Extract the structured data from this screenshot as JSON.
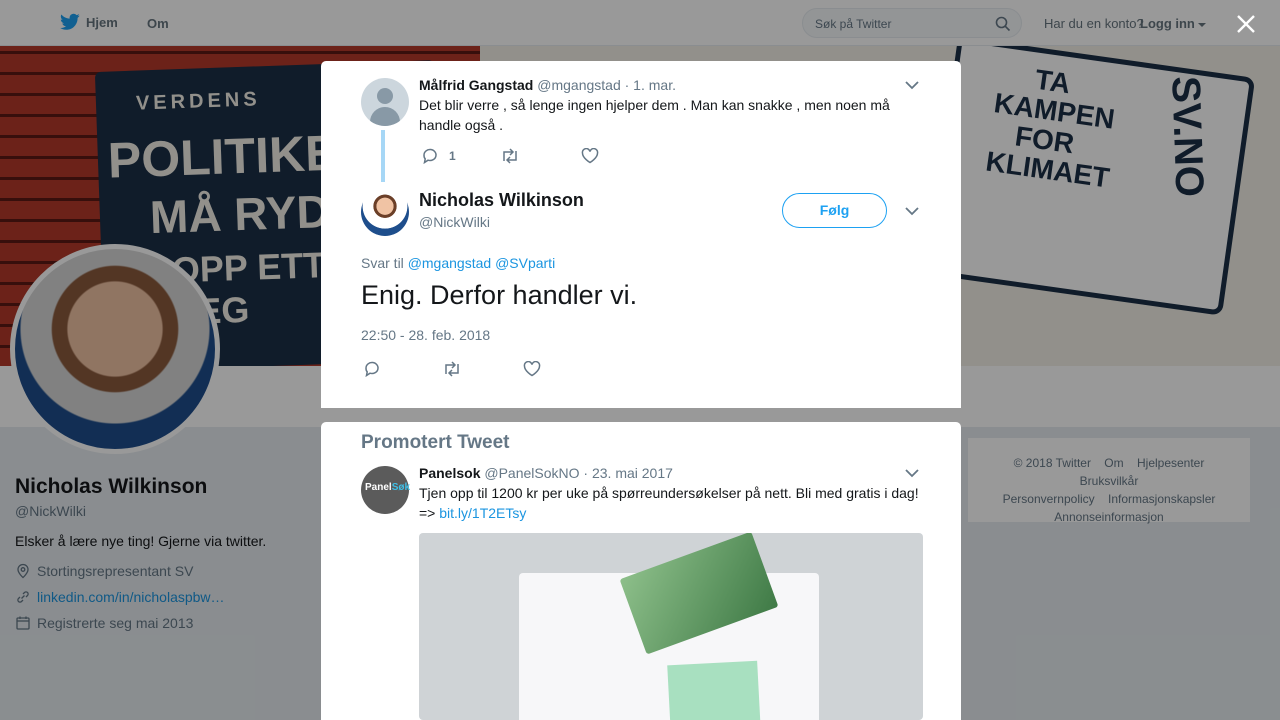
{
  "nav": {
    "home_label": "Hjem",
    "about_label": "Om",
    "search_placeholder": "Søk på Twitter",
    "account_question": "Har du en konto?",
    "login_label": "Logg inn"
  },
  "banner": {
    "poster_line1": "VERDENS",
    "poster_line2": "POLITIKERE",
    "poster_line3": "MÅ RYDDE",
    "poster_line4": "OPP ETTER SEG",
    "book_text": "TA KAMPEN FOR KLIMAET",
    "book_site": "SV.NO"
  },
  "profile": {
    "name": "Nicholas Wilkinson",
    "handle": "@NickWilki",
    "bio": "Elsker å lære nye ting! Gjerne via twitter.",
    "location": "Stortingsrepresentant SV",
    "website": "linkedin.com/in/nicholaspbw…",
    "joined": "Registrerte seg mai 2013"
  },
  "footer": {
    "copyright": "© 2018 Twitter",
    "about": "Om",
    "help": "Hjelpesenter",
    "terms": "Bruksvilkår",
    "privacy": "Personvernpolicy",
    "cookies": "Informasjonskapsler",
    "ads": "Annonseinformasjon"
  },
  "parent_tweet": {
    "name": "Målfrid Gangstad",
    "handle": "@mgangstad",
    "date": "· 1. mar.",
    "text": "Det blir verre , så lenge ingen hjelper dem . Man kan snakke , men noen må handle også .",
    "reply_count": "1"
  },
  "main_tweet": {
    "name": "Nicholas Wilkinson",
    "handle": "@NickWilki",
    "follow_label": "Følg",
    "reply_prefix": "Svar til",
    "reply_to_1": "@mgangstad",
    "reply_to_2": "@SVparti",
    "text": "Enig. Derfor handler vi.",
    "timestamp": "22:50 - 28. feb. 2018"
  },
  "promoted": {
    "section_title": "Promotert Tweet",
    "name": "Panelsok",
    "handle": "@PanelSokNO",
    "date": "· 23. mai 2017",
    "text": "Tjen opp til 1200 kr per uke på spørreundersøkelser på nett. Bli med gratis i dag! =>",
    "link": "bit.ly/1T2ETsy",
    "avatar_text_a": "Panel",
    "avatar_text_b": "Søk"
  },
  "colors": {
    "accent": "#1da1f2",
    "link": "#1b95e0",
    "muted": "#657786"
  }
}
